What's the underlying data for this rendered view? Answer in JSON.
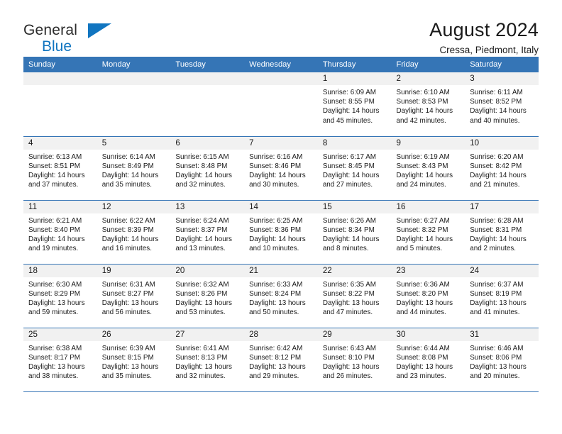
{
  "brand": {
    "name_line1": "General",
    "name_line2": "Blue",
    "flag_icon": "triangle-flag-icon",
    "accent_color": "#1175c0"
  },
  "header": {
    "title": "August 2024",
    "location": "Cressa, Piedmont, Italy"
  },
  "calendar": {
    "header_bg": "#3575b6",
    "daynum_bg": "#f1f1f1",
    "weekday_headers": [
      "Sunday",
      "Monday",
      "Tuesday",
      "Wednesday",
      "Thursday",
      "Friday",
      "Saturday"
    ],
    "weeks": [
      [
        {
          "day": "",
          "empty": true
        },
        {
          "day": "",
          "empty": true
        },
        {
          "day": "",
          "empty": true
        },
        {
          "day": "",
          "empty": true
        },
        {
          "day": "1",
          "sunrise": "Sunrise: 6:09 AM",
          "sunset": "Sunset: 8:55 PM",
          "daylight": "Daylight: 14 hours and 45 minutes."
        },
        {
          "day": "2",
          "sunrise": "Sunrise: 6:10 AM",
          "sunset": "Sunset: 8:53 PM",
          "daylight": "Daylight: 14 hours and 42 minutes."
        },
        {
          "day": "3",
          "sunrise": "Sunrise: 6:11 AM",
          "sunset": "Sunset: 8:52 PM",
          "daylight": "Daylight: 14 hours and 40 minutes."
        }
      ],
      [
        {
          "day": "4",
          "sunrise": "Sunrise: 6:13 AM",
          "sunset": "Sunset: 8:51 PM",
          "daylight": "Daylight: 14 hours and 37 minutes."
        },
        {
          "day": "5",
          "sunrise": "Sunrise: 6:14 AM",
          "sunset": "Sunset: 8:49 PM",
          "daylight": "Daylight: 14 hours and 35 minutes."
        },
        {
          "day": "6",
          "sunrise": "Sunrise: 6:15 AM",
          "sunset": "Sunset: 8:48 PM",
          "daylight": "Daylight: 14 hours and 32 minutes."
        },
        {
          "day": "7",
          "sunrise": "Sunrise: 6:16 AM",
          "sunset": "Sunset: 8:46 PM",
          "daylight": "Daylight: 14 hours and 30 minutes."
        },
        {
          "day": "8",
          "sunrise": "Sunrise: 6:17 AM",
          "sunset": "Sunset: 8:45 PM",
          "daylight": "Daylight: 14 hours and 27 minutes."
        },
        {
          "day": "9",
          "sunrise": "Sunrise: 6:19 AM",
          "sunset": "Sunset: 8:43 PM",
          "daylight": "Daylight: 14 hours and 24 minutes."
        },
        {
          "day": "10",
          "sunrise": "Sunrise: 6:20 AM",
          "sunset": "Sunset: 8:42 PM",
          "daylight": "Daylight: 14 hours and 21 minutes."
        }
      ],
      [
        {
          "day": "11",
          "sunrise": "Sunrise: 6:21 AM",
          "sunset": "Sunset: 8:40 PM",
          "daylight": "Daylight: 14 hours and 19 minutes."
        },
        {
          "day": "12",
          "sunrise": "Sunrise: 6:22 AM",
          "sunset": "Sunset: 8:39 PM",
          "daylight": "Daylight: 14 hours and 16 minutes."
        },
        {
          "day": "13",
          "sunrise": "Sunrise: 6:24 AM",
          "sunset": "Sunset: 8:37 PM",
          "daylight": "Daylight: 14 hours and 13 minutes."
        },
        {
          "day": "14",
          "sunrise": "Sunrise: 6:25 AM",
          "sunset": "Sunset: 8:36 PM",
          "daylight": "Daylight: 14 hours and 10 minutes."
        },
        {
          "day": "15",
          "sunrise": "Sunrise: 6:26 AM",
          "sunset": "Sunset: 8:34 PM",
          "daylight": "Daylight: 14 hours and 8 minutes."
        },
        {
          "day": "16",
          "sunrise": "Sunrise: 6:27 AM",
          "sunset": "Sunset: 8:32 PM",
          "daylight": "Daylight: 14 hours and 5 minutes."
        },
        {
          "day": "17",
          "sunrise": "Sunrise: 6:28 AM",
          "sunset": "Sunset: 8:31 PM",
          "daylight": "Daylight: 14 hours and 2 minutes."
        }
      ],
      [
        {
          "day": "18",
          "sunrise": "Sunrise: 6:30 AM",
          "sunset": "Sunset: 8:29 PM",
          "daylight": "Daylight: 13 hours and 59 minutes."
        },
        {
          "day": "19",
          "sunrise": "Sunrise: 6:31 AM",
          "sunset": "Sunset: 8:27 PM",
          "daylight": "Daylight: 13 hours and 56 minutes."
        },
        {
          "day": "20",
          "sunrise": "Sunrise: 6:32 AM",
          "sunset": "Sunset: 8:26 PM",
          "daylight": "Daylight: 13 hours and 53 minutes."
        },
        {
          "day": "21",
          "sunrise": "Sunrise: 6:33 AM",
          "sunset": "Sunset: 8:24 PM",
          "daylight": "Daylight: 13 hours and 50 minutes."
        },
        {
          "day": "22",
          "sunrise": "Sunrise: 6:35 AM",
          "sunset": "Sunset: 8:22 PM",
          "daylight": "Daylight: 13 hours and 47 minutes."
        },
        {
          "day": "23",
          "sunrise": "Sunrise: 6:36 AM",
          "sunset": "Sunset: 8:20 PM",
          "daylight": "Daylight: 13 hours and 44 minutes."
        },
        {
          "day": "24",
          "sunrise": "Sunrise: 6:37 AM",
          "sunset": "Sunset: 8:19 PM",
          "daylight": "Daylight: 13 hours and 41 minutes."
        }
      ],
      [
        {
          "day": "25",
          "sunrise": "Sunrise: 6:38 AM",
          "sunset": "Sunset: 8:17 PM",
          "daylight": "Daylight: 13 hours and 38 minutes."
        },
        {
          "day": "26",
          "sunrise": "Sunrise: 6:39 AM",
          "sunset": "Sunset: 8:15 PM",
          "daylight": "Daylight: 13 hours and 35 minutes."
        },
        {
          "day": "27",
          "sunrise": "Sunrise: 6:41 AM",
          "sunset": "Sunset: 8:13 PM",
          "daylight": "Daylight: 13 hours and 32 minutes."
        },
        {
          "day": "28",
          "sunrise": "Sunrise: 6:42 AM",
          "sunset": "Sunset: 8:12 PM",
          "daylight": "Daylight: 13 hours and 29 minutes."
        },
        {
          "day": "29",
          "sunrise": "Sunrise: 6:43 AM",
          "sunset": "Sunset: 8:10 PM",
          "daylight": "Daylight: 13 hours and 26 minutes."
        },
        {
          "day": "30",
          "sunrise": "Sunrise: 6:44 AM",
          "sunset": "Sunset: 8:08 PM",
          "daylight": "Daylight: 13 hours and 23 minutes."
        },
        {
          "day": "31",
          "sunrise": "Sunrise: 6:46 AM",
          "sunset": "Sunset: 8:06 PM",
          "daylight": "Daylight: 13 hours and 20 minutes."
        }
      ]
    ]
  }
}
